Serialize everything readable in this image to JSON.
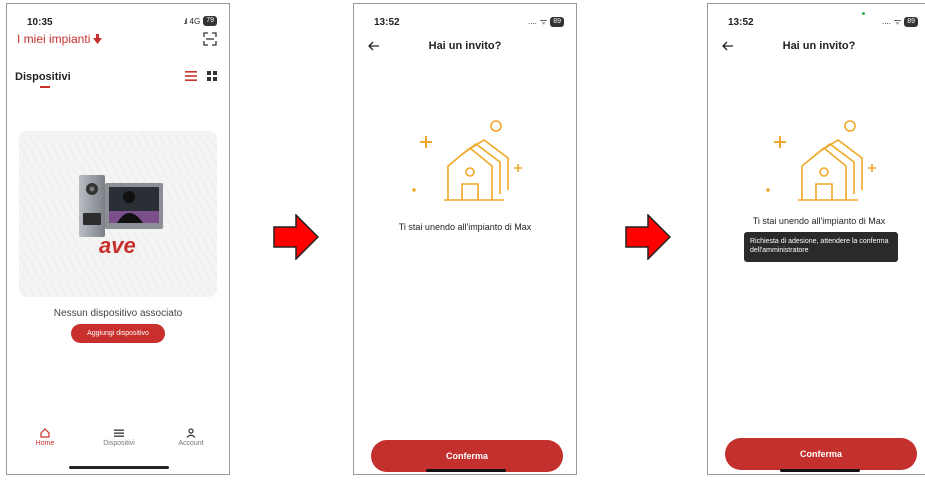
{
  "screen1": {
    "time": "10:35",
    "signal": "4G",
    "battery": "79",
    "title": "I miei impianti",
    "section_title": "Dispositivi",
    "brand": "ave",
    "empty_message": "Nessun dispositivo associato",
    "add_button": "Aggiungi dispositivo",
    "tabs": [
      {
        "label": "Home",
        "icon": "home-icon",
        "active": true
      },
      {
        "label": "Dispositivi",
        "icon": "menu-icon",
        "active": false
      },
      {
        "label": "Account",
        "icon": "user-icon",
        "active": false
      }
    ]
  },
  "screen2": {
    "time": "13:52",
    "battery": "89",
    "header_title": "Hai un invito?",
    "message": "Ti stai unendo all'impianto di Max",
    "confirm_button": "Conferma"
  },
  "screen3": {
    "time": "13:52",
    "battery": "89",
    "header_title": "Hai un invito?",
    "message": "Ti stai unendo all'impianto di Max",
    "tooltip": "Richiesta di adesione, attendere la conferma dell'amministratore",
    "confirm_button": "Conferma"
  },
  "colors": {
    "accent_red": "#c7302c",
    "illustration_orange": "#f0a825",
    "arrow_red": "#ff0000"
  }
}
